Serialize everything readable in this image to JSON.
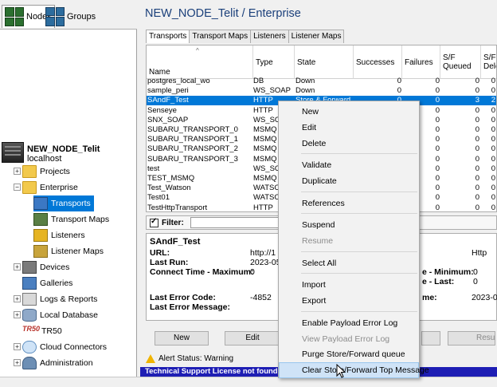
{
  "left_tabs": {
    "nodes": "Nodes",
    "groups": "Groups"
  },
  "tree": {
    "root_name": "NEW_NODE_Telit",
    "root_host": "localhost",
    "items": {
      "projects": "Projects",
      "enterprise": "Enterprise",
      "transports": "Transports",
      "transport_maps": "Transport Maps",
      "listeners": "Listeners",
      "listener_maps": "Listener Maps",
      "devices": "Devices",
      "galleries": "Galleries",
      "logs_reports": "Logs & Reports",
      "local_database": "Local Database",
      "tr50_icon_text": "TR50",
      "tr50": "TR50",
      "cloud_connectors": "Cloud Connectors",
      "administration": "Administration"
    }
  },
  "header": {
    "title": "NEW_NODE_Telit / Enterprise"
  },
  "tabs": [
    "Transports",
    "Transport Maps",
    "Listeners",
    "Listener Maps"
  ],
  "grid": {
    "columns": {
      "name": "Name",
      "type": "Type",
      "state": "State",
      "successes": "Successes",
      "failures": "Failures",
      "sf_queued": "S/F Queued",
      "sf_deleted": "S/F Delet"
    },
    "rows": [
      {
        "name": "postgres_local_wo",
        "type": "DB",
        "state": "Down",
        "succ": "0",
        "fail": "0",
        "q": "0",
        "d": "0"
      },
      {
        "name": "sample_peri",
        "type": "WS_SOAP",
        "state": "Down",
        "succ": "0",
        "fail": "0",
        "q": "0",
        "d": "0"
      },
      {
        "name": "SAndF_Test",
        "type": "HTTP",
        "state": "Store & Forward",
        "succ": "0",
        "fail": "0",
        "q": "3",
        "d": "2"
      },
      {
        "name": "Senseye",
        "type": "HTTP",
        "state": "",
        "succ": "",
        "fail": "0",
        "q": "0",
        "d": "0"
      },
      {
        "name": "SNX_SOAP",
        "type": "WS_SOA",
        "state": "",
        "succ": "",
        "fail": "0",
        "q": "0",
        "d": "0"
      },
      {
        "name": "SUBARU_TRANSPORT_0",
        "type": "MSMQ",
        "state": "",
        "succ": "",
        "fail": "0",
        "q": "0",
        "d": "0"
      },
      {
        "name": "SUBARU_TRANSPORT_1",
        "type": "MSMQ",
        "state": "",
        "succ": "",
        "fail": "0",
        "q": "0",
        "d": "0"
      },
      {
        "name": "SUBARU_TRANSPORT_2",
        "type": "MSMQ",
        "state": "",
        "succ": "",
        "fail": "0",
        "q": "0",
        "d": "0"
      },
      {
        "name": "SUBARU_TRANSPORT_3",
        "type": "MSMQ",
        "state": "",
        "succ": "",
        "fail": "0",
        "q": "0",
        "d": "0"
      },
      {
        "name": "test",
        "type": "WS_SOA",
        "state": "",
        "succ": "",
        "fail": "0",
        "q": "0",
        "d": "0"
      },
      {
        "name": "TEST_MSMQ",
        "type": "MSMQ",
        "state": "",
        "succ": "",
        "fail": "0",
        "q": "0",
        "d": "0"
      },
      {
        "name": "Test_Watson",
        "type": "WATSON",
        "state": "",
        "succ": "",
        "fail": "0",
        "q": "0",
        "d": "0"
      },
      {
        "name": "Test01",
        "type": "WATSON",
        "state": "",
        "succ": "",
        "fail": "0",
        "q": "0",
        "d": "0"
      },
      {
        "name": "TestHttpTransport",
        "type": "HTTP",
        "state": "",
        "succ": "",
        "fail": "0",
        "q": "0",
        "d": "0"
      }
    ],
    "selected_index": 2
  },
  "filter": {
    "label": "Filter:"
  },
  "details": {
    "title": "SAndF_Test",
    "url_label": "URL:",
    "url_value": "http://1",
    "last_run_label": "Last Run:",
    "last_run_value": "2023-05",
    "connect_label": "Connect Time - Maximum:",
    "connect_value": "0",
    "right_type": "Http",
    "min_label": "e - Minimum:",
    "min_value": "0",
    "last_label": "e - Last:",
    "last_value": "0",
    "error_code_label": "Last Error Code:",
    "error_code_value": "-4852",
    "error_msg_label": "Last Error Message:",
    "time_label": "me:",
    "time_value": "2023-05"
  },
  "buttons": {
    "new": "New",
    "edit": "Edit",
    "resume": "Resume"
  },
  "status": {
    "alert": "Alert Status: Warning",
    "license": "Technical Support License not found"
  },
  "context_menu": {
    "items": [
      {
        "label": "New",
        "enabled": true
      },
      {
        "label": "Edit",
        "enabled": true
      },
      {
        "label": "Delete",
        "enabled": true
      },
      {
        "label": "Validate",
        "enabled": true
      },
      {
        "label": "Duplicate",
        "enabled": true
      },
      {
        "label": "References",
        "enabled": true
      },
      {
        "label": "Suspend",
        "enabled": true
      },
      {
        "label": "Resume",
        "enabled": false
      },
      {
        "label": "Select All",
        "enabled": true
      },
      {
        "label": "Import",
        "enabled": true
      },
      {
        "label": "Export",
        "enabled": true
      },
      {
        "label": "Enable Payload Error Log",
        "enabled": true
      },
      {
        "label": "View Payload Error Log",
        "enabled": false
      },
      {
        "label": "Purge Store/Forward queue",
        "enabled": true
      },
      {
        "label": "Clear Store/Forward Top Message",
        "enabled": true
      }
    ],
    "hovered": "Clear Store/Forward Top Message"
  },
  "colors": {
    "selection": "#0078d7",
    "title": "#1a3f7a",
    "license_bar": "#1e1eb4",
    "menu_hover": "#cfe3f7",
    "warning": "#f0b400"
  }
}
